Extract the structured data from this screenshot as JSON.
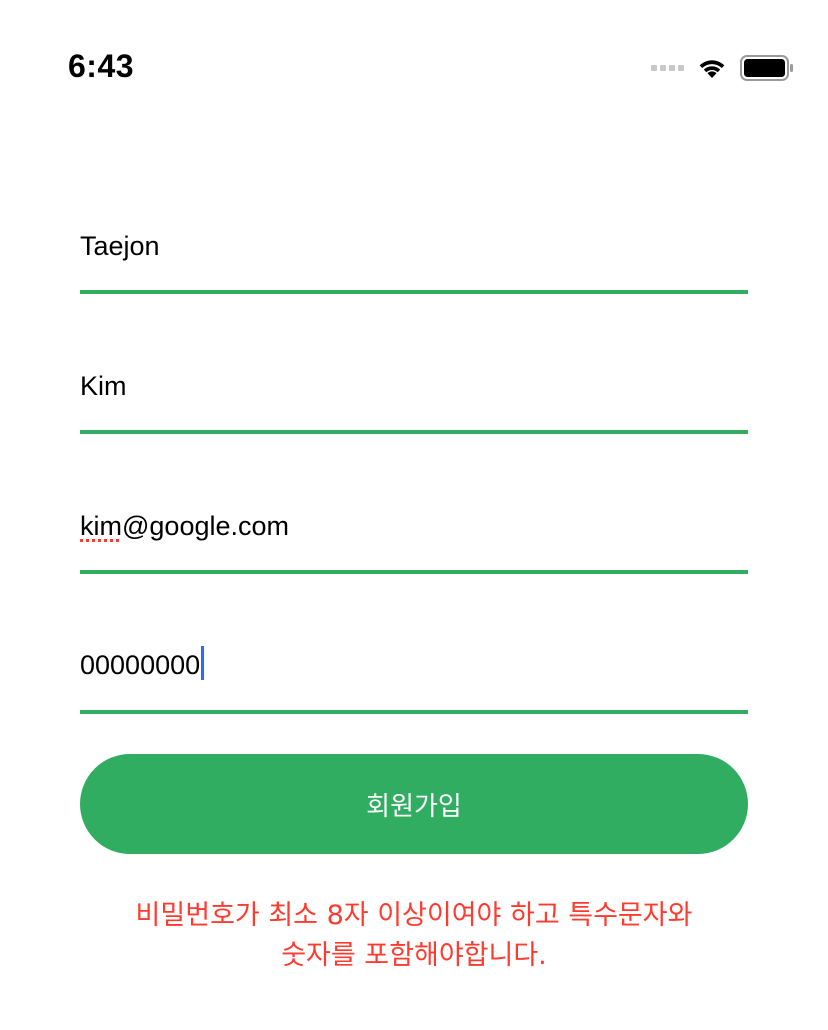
{
  "status_bar": {
    "time": "6:43",
    "icons": [
      "signal-dots-icon",
      "wifi-icon",
      "battery-icon"
    ]
  },
  "form": {
    "first_name": "Taejon",
    "last_name": "Kim",
    "email_misspelled_part": "kim",
    "email_rest": "@google.com",
    "password": "00000000"
  },
  "signup_button": {
    "label": "회원가입"
  },
  "error": {
    "line1": "비밀번호가 최소 8자 이상이여야 하고 특수문자와",
    "line2": "숫자를 포함해야합니다."
  },
  "colors": {
    "accent": "#31ad62",
    "error": "#ff3b30",
    "cursor": "#2f6bff"
  }
}
